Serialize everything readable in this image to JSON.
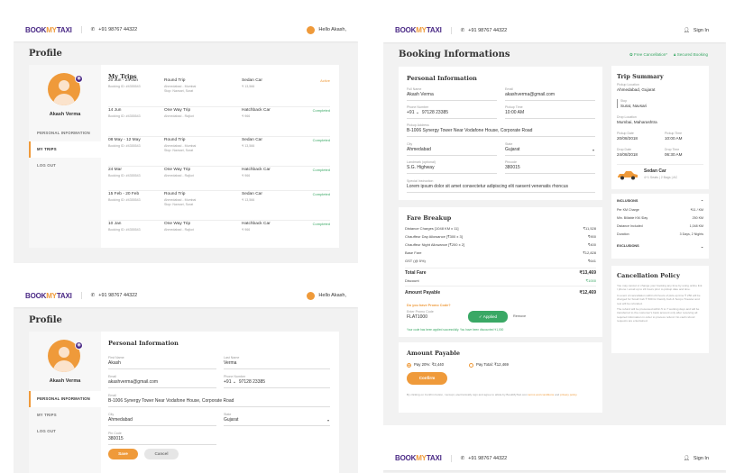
{
  "brand": {
    "logo_a": "BOOK",
    "logo_b": "MY",
    "logo_c": "TAXI",
    "phone": "+91 98767 44322",
    "greeting": "Hello Akash,",
    "sign_in": "Sign In"
  },
  "profile": {
    "title": "Profile",
    "user_name": "Akash Verma",
    "nav": [
      "PERSONAL INFORMATION",
      "MY TRIPS",
      "LOG OUT"
    ],
    "trips_title": "My Trips",
    "trips": [
      {
        "date": "20 Jun - 24 Jun",
        "booking": "Booking ID: #4355543",
        "type": "Round Trip",
        "route": "Ahmedabad - Mumbai",
        "stop": "Stop: Navsari, Surat",
        "car": "Sedan Car",
        "price": "₹ 13,566",
        "status": "Active"
      },
      {
        "date": "14 Jun",
        "booking": "Booking ID: #4355543",
        "type": "One Way Trip",
        "route": "Ahmedabad - Rajkot",
        "stop": "",
        "car": "Hatchback Car",
        "price": "₹ 966",
        "status": "Completed"
      },
      {
        "date": "08 May - 12 May",
        "booking": "Booking ID: #4355543",
        "type": "Round Trip",
        "route": "Ahmedabad - Mumbai",
        "stop": "Stop: Navsari, Surat",
        "car": "Sedan Car",
        "price": "₹ 13,566",
        "status": "Completed"
      },
      {
        "date": "24 Mar",
        "booking": "Booking ID: #4355543",
        "type": "One Way Trip",
        "route": "Ahmedabad - Rajkot",
        "stop": "",
        "car": "Hatchback Car",
        "price": "₹ 966",
        "status": "Completed"
      },
      {
        "date": "15 Feb - 20 Feb",
        "booking": "Booking ID: #4355543",
        "type": "Round Trip",
        "route": "Ahmedabad - Mumbai",
        "stop": "Stop: Navsari, Surat",
        "car": "Sedan Car",
        "price": "₹ 13,566",
        "status": "Completed"
      },
      {
        "date": "10 Jan",
        "booking": "Booking ID: #4355543",
        "type": "One Way Trip",
        "route": "Ahmedabad - Rajkot",
        "stop": "",
        "car": "Hatchback Car",
        "price": "₹ 966",
        "status": "Completed"
      }
    ],
    "personal": {
      "title": "Personal Information",
      "first_name": {
        "label": "First Name",
        "value": "Akash"
      },
      "last_name": {
        "label": "Last Name",
        "value": "Verma"
      },
      "email": {
        "label": "Email",
        "value": "akashverma@gmail.com"
      },
      "phone": {
        "label": "Phone Number",
        "code": "+91",
        "value": "97128 23385"
      },
      "address": {
        "label": "Email",
        "value": "B-1006 Synergy Tower Near Vodafone House, Corporate Road"
      },
      "city": {
        "label": "City",
        "value": "Ahmedabad"
      },
      "state": {
        "label": "State",
        "value": "Gujarat"
      },
      "pin": {
        "label": "Pin Code",
        "value": "380015"
      },
      "save": "Save",
      "cancel": "Cancel"
    }
  },
  "booking": {
    "title": "Booking Informations",
    "free_cancel": "Free Cancellation*",
    "secured": "Secured Booking",
    "personal": {
      "title": "Personal Information",
      "full_name": {
        "label": "Full Name",
        "value": "Akash Verma"
      },
      "email": {
        "label": "Email",
        "value": "akashverma@gmail.com"
      },
      "phone": {
        "label": "Phone Number",
        "code": "+91",
        "value": "97128 23385"
      },
      "pickup_time": {
        "label": "Pickup Time",
        "value": "10:00 AM"
      },
      "address": {
        "label": "Pickup Address",
        "value": "B-1006 Synergy Tower Near Vodafone House, Corporate Road"
      },
      "city": {
        "label": "City",
        "value": "Ahmedabad"
      },
      "state": {
        "label": "State",
        "value": "Gujarat"
      },
      "landmark": {
        "label": "Landmark (optional)",
        "value": "S.G. Highway"
      },
      "pincode": {
        "label": "Pincode",
        "value": "380015"
      },
      "instruction": {
        "label": "Special Instruction",
        "value": "Lorem ipsum dolor sit amet consectetur adipiscing elit raesent venenatis rhoncus"
      }
    },
    "fare": {
      "title": "Fare Breakup",
      "items": [
        {
          "label": "Distance Charges [1048 KM x 11]",
          "value": "₹11,528"
        },
        {
          "label": "Chauffeur Day Allowance [₹300 x 3]",
          "value": "₹900"
        },
        {
          "label": "Chauffeur Night Allowance [₹200 x 2]",
          "value": "₹400"
        },
        {
          "label": "Base Fare",
          "value": "₹12,828"
        },
        {
          "label": "GST (@ 5%)",
          "value": "₹641"
        }
      ],
      "total_label": "Total Fare",
      "total": "₹13,469",
      "discount_label": "Discount",
      "discount": "₹1000",
      "payable_label": "Amount Payable",
      "payable": "₹12,469",
      "promo_q": "Do you have Promo Code?",
      "promo_label": "Enter Promo Code",
      "promo_value": "FLAT1000",
      "applied": "Applied",
      "remove": "Remove",
      "promo_msg": "Your code has been applied successfully. You have been discounted ₹1,000"
    },
    "amount": {
      "title": "Amount Payable",
      "opt1": "Pay 20%: ₹2,440",
      "opt2": "Pay Total: ₹12,469",
      "confirm": "Confirm",
      "terms_a": "By clicking on Confirm button, I accept, electronically sign and agree to abide by BookMyTaxi.com ",
      "terms_link": "terms and conditions",
      "terms_and": " and ",
      "privacy": "privacy policy."
    },
    "summary": {
      "title": "Trip Summary",
      "pickup_loc": {
        "label": "Pickup Location",
        "value": "Ahmedabad, Gujarat"
      },
      "stop": {
        "label": "Stop",
        "value": "Surat, Navsari"
      },
      "drop_loc": {
        "label": "Drop Location",
        "value": "Mumbai, Maharashtra"
      },
      "pickup_date": {
        "label": "Pickup Date",
        "value": "20/08/2018"
      },
      "pickup_time": {
        "label": "Pickup Time",
        "value": "10:00 AM"
      },
      "drop_date": {
        "label": "Drop Date",
        "value": "24/08/2018"
      },
      "drop_time": {
        "label": "Drop Time",
        "value": "06:30 AM"
      },
      "car": "Sedan Car",
      "car_info": "4+1 Seats | 2 Bags | AC"
    },
    "inclusions": {
      "title": "INCLUSIONS",
      "items": [
        {
          "label": "Per KM Charge",
          "value": "₹11 / KM"
        },
        {
          "label": "Min. Billable KM /Day",
          "value": "250 KM"
        },
        {
          "label": "Distance Included",
          "value": "1,048 KM"
        },
        {
          "label": "Duration",
          "value": "3 Days, 2 Nights"
        }
      ],
      "exclusions": "EXCLUSIONS"
    },
    "policy": {
      "title": "Cancellation Policy",
      "p1": "You may cancel or change your booking any time by using online link / phone / email up to 24 hours prior to pickup date and time.",
      "p2": "In event of cancellation within 24 hours of pick-up time ₹ 250 will be charged for Small Cab ₹ 500 for Family Cab & Tempo Traveler and rest will be refunded.",
      "p3": "The refund will be processed within 5 to 7 working days and will be transferred to the customer's bank account only after receiving all required information in order to process refund. No cash refund requests are entertained."
    }
  },
  "colors": {
    "brand": "#4b2a86",
    "accent": "#ef9a3a",
    "success": "#3aa865"
  }
}
